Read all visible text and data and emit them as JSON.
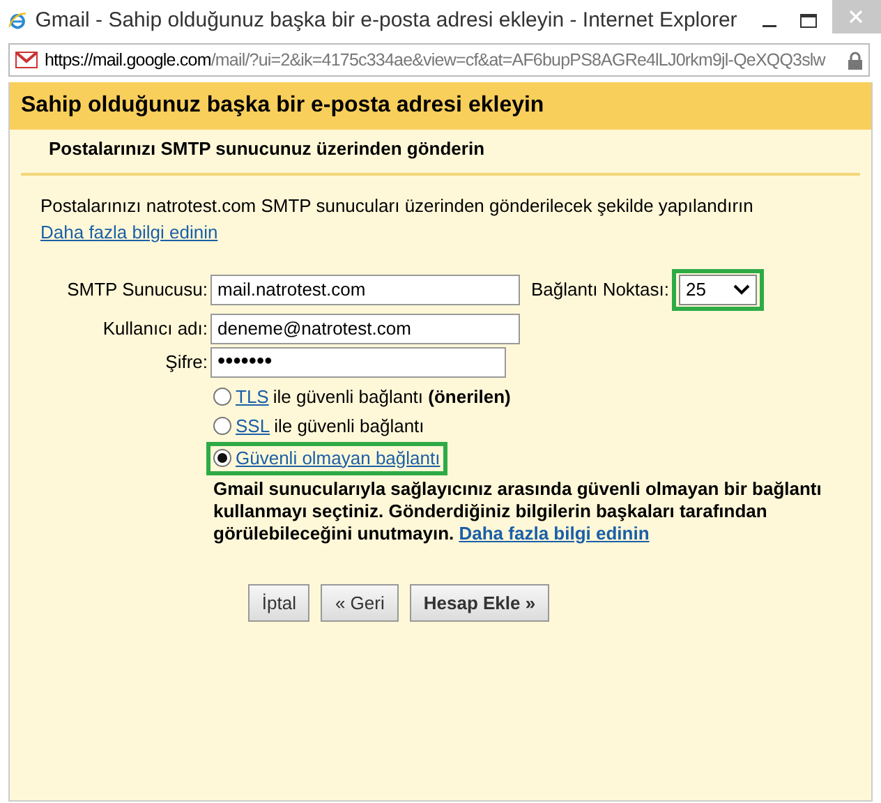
{
  "window": {
    "title": "Gmail - Sahip olduğunuz başka bir e-posta adresi ekleyin - Internet Explorer",
    "url_host": "https://mail.google.com",
    "url_path": "/mail/?ui=2&ik=4175c334ae&view=cf&at=AF6bupPS8AGRe4lLJ0rkm9jl-QeXQQ3slw"
  },
  "dialog": {
    "title": "Sahip olduğunuz başka bir e-posta adresi ekleyin",
    "subtitle": "Postalarınızı SMTP sunucunuz üzerinden gönderin",
    "intro": "Postalarınızı natrotest.com SMTP sunucuları üzerinden gönderilecek şekilde yapılandırın",
    "intro_link": "Daha fazla bilgi edinin"
  },
  "fields": [
    {
      "label": "SMTP Sunucusu:",
      "value": "mail.natrotest.com",
      "kind": "text"
    },
    {
      "label": "Kullanıcı adı:",
      "value": "deneme@natrotest.com",
      "kind": "text"
    },
    {
      "label": "Şifre:",
      "value": "•••••••",
      "kind": "password"
    }
  ],
  "port": {
    "label": "Bağlantı Noktası:",
    "value": "25",
    "highlighted": true
  },
  "security_options": [
    {
      "link": "TLS",
      "text": "ile güvenli bağlantı **(önerilen)**",
      "selected": false,
      "highlighted": false
    },
    {
      "link": "SSL",
      "text": "ile güvenli bağlantı",
      "selected": false,
      "highlighted": false
    },
    {
      "link": "Güvenli olmayan bağlantı",
      "selected": true,
      "highlighted": true
    }
  ],
  "warning": {
    "text": "Gmail sunucularıyla sağlayıcınız arasında güvenli olmayan bir bağlantı kullanmayı seçtiniz. Gönderdiğiniz bilgilerin başkaları tarafından görülebileceğini unutmayın.",
    "link": "Daha fazla bilgi edinin"
  },
  "buttons": [
    {
      "label": "İptal",
      "kind": "plain"
    },
    {
      "label": "« Geri",
      "kind": "plain"
    },
    {
      "label": "Hesap Ekle »",
      "kind": "primary"
    }
  ]
}
